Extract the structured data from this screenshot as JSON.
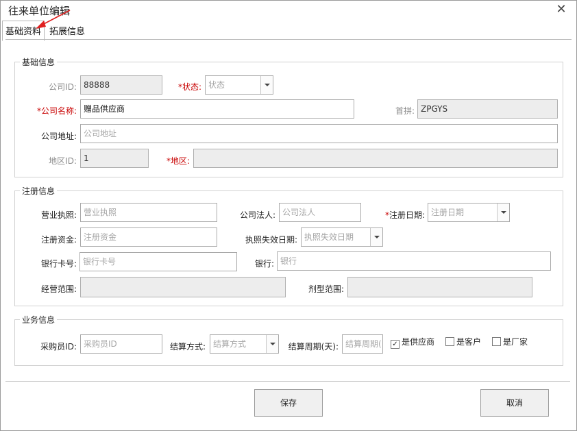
{
  "window": {
    "title": "往来单位编辑",
    "close_glyph": "✕"
  },
  "tabs": [
    {
      "label": "基础资料"
    },
    {
      "label": "拓展信息"
    }
  ],
  "basic": {
    "group_title": "基础信息",
    "company_id": {
      "label": "公司ID:",
      "value": "88888"
    },
    "status": {
      "label": "*状态:",
      "placeholder": "状态"
    },
    "company_name": {
      "label": "*公司名称:",
      "value": "赠品供应商"
    },
    "pinyin": {
      "label": "首拼:",
      "value": "ZPGYS"
    },
    "address": {
      "label": "公司地址:",
      "placeholder": "公司地址"
    },
    "region_id": {
      "label": "地区ID:",
      "value": "1"
    },
    "region": {
      "label": "*地区:",
      "value": ""
    }
  },
  "registration": {
    "group_title": "注册信息",
    "license": {
      "label": "营业执照:",
      "placeholder": "营业执照"
    },
    "legal_person": {
      "label": "公司法人:",
      "placeholder": "公司法人"
    },
    "reg_date": {
      "star": "*",
      "label": "注册日期:",
      "placeholder": "注册日期"
    },
    "capital": {
      "label": "注册资金:",
      "placeholder": "注册资金"
    },
    "license_expiry": {
      "label": "执照失效日期:",
      "placeholder": "执照失效日期"
    },
    "bank_card": {
      "label": "银行卡号:",
      "placeholder": "银行卡号"
    },
    "bank": {
      "label": "银行:",
      "placeholder": "银行"
    },
    "business_scope": {
      "label": "经营范围:",
      "value": ""
    },
    "dosage_scope": {
      "label": "剂型范围:",
      "value": ""
    }
  },
  "business": {
    "group_title": "业务信息",
    "buyer_id": {
      "label": "采购员ID:",
      "placeholder": "采购员ID"
    },
    "settle_method": {
      "label": "结算方式:",
      "placeholder": "结算方式"
    },
    "settle_period": {
      "label": "结算周期(天):",
      "placeholder": "结算周期("
    },
    "is_supplier": {
      "label": "是供应商",
      "checked": true
    },
    "is_customer": {
      "label": "是客户",
      "checked": false
    },
    "is_manufacturer": {
      "label": "是厂家",
      "checked": false
    }
  },
  "buttons": {
    "save": "保存",
    "cancel": "取消"
  },
  "colors": {
    "required": "#c80000",
    "annotation_arrow": "#e02020"
  }
}
